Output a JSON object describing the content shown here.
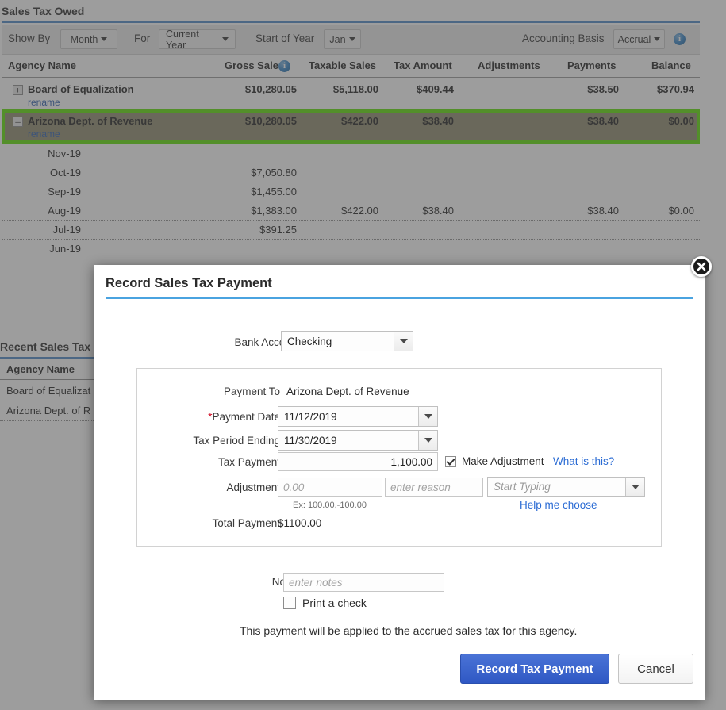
{
  "background": {
    "panel_title": "Sales Tax Owed",
    "filters": {
      "show_by_label": "Show By",
      "show_by_value": "Month",
      "for_label": "For",
      "for_value": "Current Year",
      "start_of_year_label": "Start of Year",
      "start_of_year_value": "Jan",
      "accounting_basis_label": "Accounting Basis",
      "accounting_basis_value": "Accrual",
      "info_icon": "info-icon"
    },
    "table": {
      "columns": [
        "Agency Name",
        "Gross Sales",
        "Taxable Sales",
        "Tax Amount",
        "Adjustments",
        "Payments",
        "Balance"
      ],
      "gross_sales_info_icon": "info-icon",
      "rows": [
        {
          "expander": "+",
          "agency": "Board of Equalization",
          "rename": "rename",
          "gross_sales": "$10,280.05",
          "taxable_sales": "$5,118.00",
          "tax_amount": "$409.44",
          "adjustments": "",
          "payments": "$38.50",
          "balance": "$370.94"
        },
        {
          "expander": "–",
          "agency": "Arizona Dept. of Revenue",
          "rename": "rename",
          "gross_sales": "$10,280.05",
          "taxable_sales": "$422.00",
          "tax_amount": "$38.40",
          "adjustments": "",
          "payments": "$38.40",
          "balance": "$0.00",
          "highlighted": true
        }
      ],
      "sub_rows": [
        {
          "period": "Nov-19",
          "gross_sales": "",
          "taxable_sales": "",
          "tax_amount": "",
          "adjustments": "",
          "payments": "",
          "balance": ""
        },
        {
          "period": "Oct-19",
          "gross_sales": "$7,050.80",
          "taxable_sales": "",
          "tax_amount": "",
          "adjustments": "",
          "payments": "",
          "balance": ""
        },
        {
          "period": "Sep-19",
          "gross_sales": "$1,455.00",
          "taxable_sales": "",
          "tax_amount": "",
          "adjustments": "",
          "payments": "",
          "balance": ""
        },
        {
          "period": "Aug-19",
          "gross_sales": "$1,383.00",
          "taxable_sales": "$422.00",
          "tax_amount": "$38.40",
          "adjustments": "",
          "payments": "$38.40",
          "balance": "$0.00"
        },
        {
          "period": "Jul-19",
          "gross_sales": "$391.25",
          "taxable_sales": "",
          "tax_amount": "",
          "adjustments": "",
          "payments": "",
          "balance": ""
        },
        {
          "period": "Jun-19",
          "gross_sales": "",
          "taxable_sales": "",
          "tax_amount": "",
          "adjustments": "",
          "payments": "",
          "balance": ""
        }
      ]
    },
    "recent": {
      "title": "Recent Sales Tax",
      "column": "Agency Name",
      "rows": [
        "Board of Equalizat",
        "Arizona Dept. of R"
      ]
    }
  },
  "modal": {
    "title": "Record Sales Tax Payment",
    "close_icon": "close-icon",
    "bank_account_label": "Bank Account",
    "bank_account_value": "Checking",
    "payment_to_label": "Payment To",
    "payment_to_value": "Arizona Dept. of Revenue",
    "payment_date_label": "Payment Date",
    "payment_date_required": "*",
    "payment_date_value": "11/12/2019",
    "tax_period_label": "Tax Period Ending",
    "tax_period_value": "11/30/2019",
    "tax_payment_label": "Tax Payment",
    "tax_payment_value": "1,100.00",
    "make_adjustment_label": "Make Adjustment",
    "make_adjustment_checked": true,
    "what_is_this_link": "What is this?",
    "adjustment_label": "Adjustment",
    "adjustment_amount_placeholder": "0.00",
    "adjustment_reason_placeholder": "enter reason",
    "adjustment_account_placeholder": "Start Typing",
    "adjustment_hint": "Ex: 100.00,-100.00",
    "help_me_choose_link": "Help me choose",
    "total_payment_label": "Total Payment",
    "total_payment_value": "$1100.00",
    "notes_label": "Notes",
    "notes_placeholder": "enter notes",
    "print_check_label": "Print a check",
    "print_check_checked": false,
    "footer_note": "This payment will be applied to the accrued sales tax for this agency.",
    "record_button": "Record Tax Payment",
    "cancel_button": "Cancel"
  },
  "colors": {
    "accent_blue": "#4aa3e0",
    "primary_button": "#2f58c4",
    "link": "#2a6bd4",
    "highlight_green": "#5ce000",
    "required_red": "#d0021b"
  }
}
